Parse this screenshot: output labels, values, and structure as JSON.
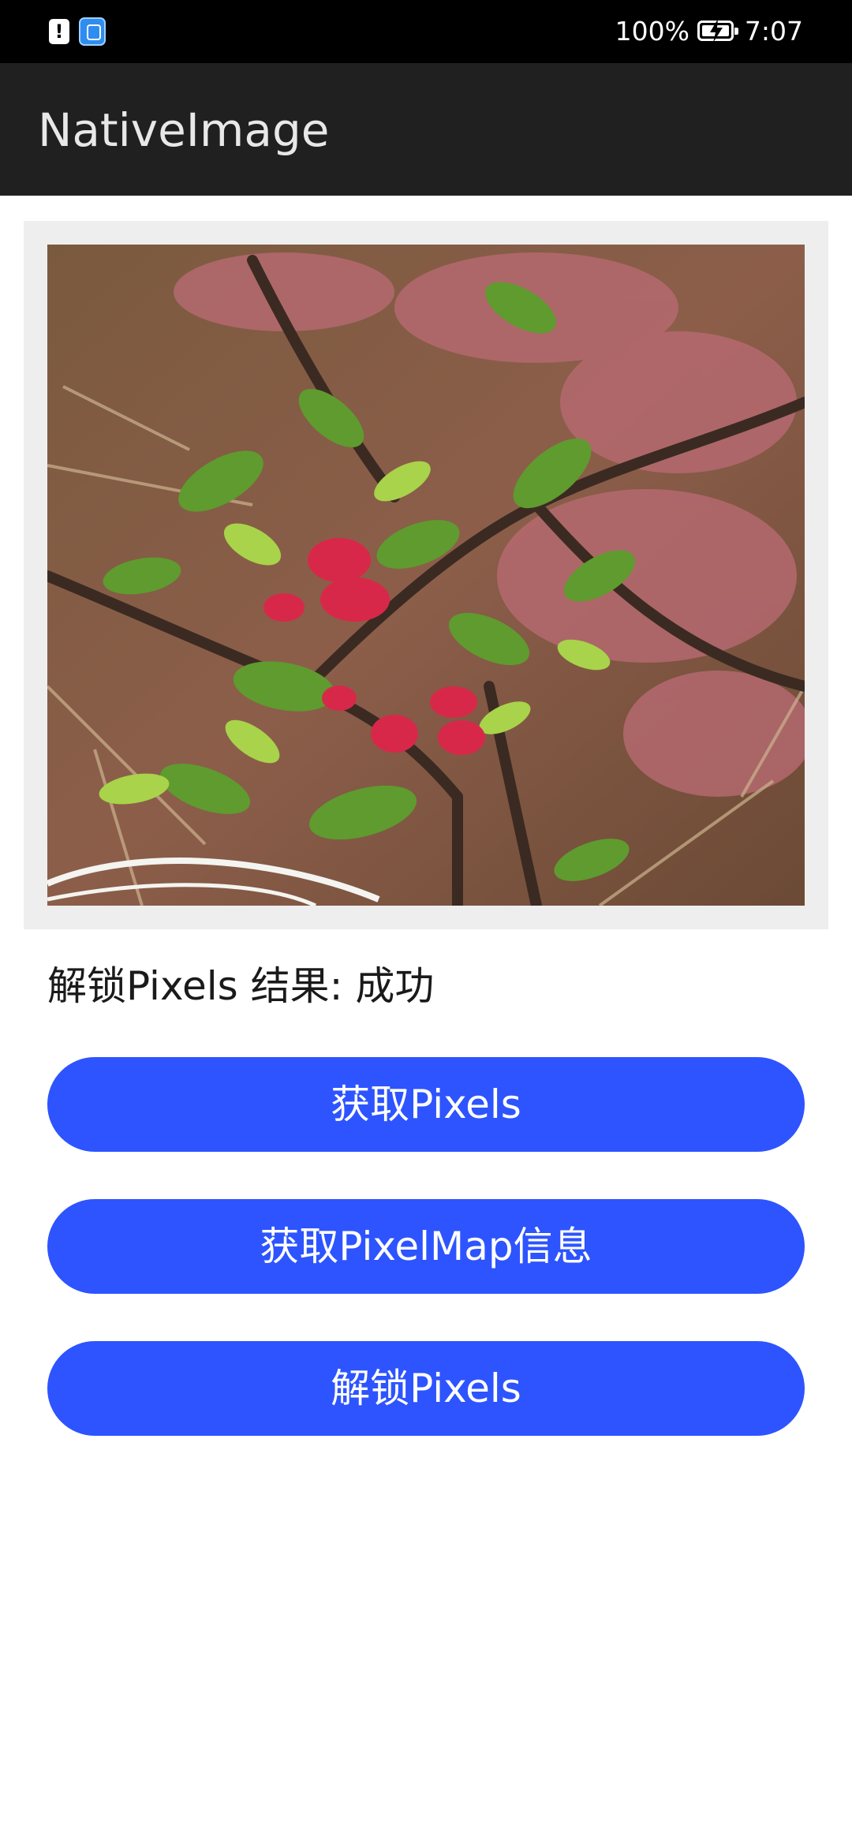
{
  "status_bar": {
    "battery": "100%",
    "time": "7:07",
    "icons": [
      "alert-notification-icon",
      "app-notification-icon",
      "battery-charging-icon"
    ]
  },
  "app_bar": {
    "title": "NativeImage"
  },
  "content": {
    "image_alt": "flowering quince branch photo",
    "result_text": "解锁Pixels 结果: 成功",
    "buttons": [
      {
        "label": "获取Pixels"
      },
      {
        "label": "获取PixelMap信息"
      },
      {
        "label": "解锁Pixels"
      }
    ]
  },
  "colors": {
    "status_bar": "#000000",
    "app_bar": "#202020",
    "button": "#2d54ff",
    "panel": "#eeeeee"
  }
}
